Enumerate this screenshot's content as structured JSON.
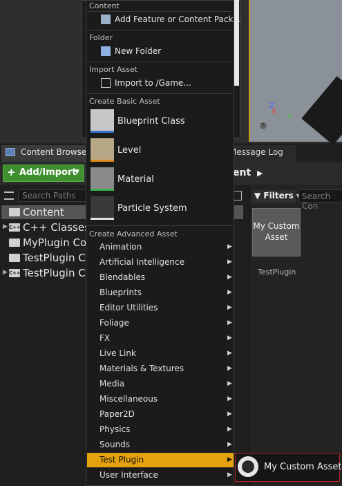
{
  "tabs": {
    "content_browser": "Content Browser",
    "message_log": "Message Log"
  },
  "toolbar": {
    "add_import": "Add/Import",
    "breadcrumb": "ent"
  },
  "left_panel": {
    "search_placeholder": "Search Paths",
    "tree": [
      {
        "label": "Content",
        "kind": "folder",
        "selected": true
      },
      {
        "label": "C++ Classes",
        "kind": "cpp-folder",
        "expandable": true
      },
      {
        "label": "MyPlugin Cor",
        "kind": "folder"
      },
      {
        "label": "TestPlugin Co",
        "kind": "folder"
      },
      {
        "label": "TestPlugin C+",
        "kind": "cpp-folder",
        "expandable": true
      }
    ]
  },
  "right_panel": {
    "filters": "Filters",
    "search_placeholder": "Search Con",
    "asset": {
      "name": "My Custom Asset",
      "folder": "TestPlugin"
    }
  },
  "viewport": {
    "axis_z": "Z",
    "axis_x": "X",
    "axis_y": "Y"
  },
  "menu": {
    "sections": {
      "content": "Content",
      "folder": "Folder",
      "import": "Import Asset",
      "basic": "Create Basic Asset",
      "advanced": "Create Advanced Asset"
    },
    "add_feature": "Add Feature or Content Pack...",
    "new_folder": "New Folder",
    "import_to": "Import to /Game...",
    "basic_items": [
      {
        "label": "Blueprint Class",
        "accent": "#3a78d4"
      },
      {
        "label": "Level",
        "accent": "#e08a1a"
      },
      {
        "label": "Material",
        "accent": "#3ab04a"
      },
      {
        "label": "Particle System",
        "accent": "#e0e0e0"
      }
    ],
    "advanced_items": [
      "Animation",
      "Artificial Intelligence",
      "Blendables",
      "Blueprints",
      "Editor Utilities",
      "Foliage",
      "FX",
      "Live Link",
      "Materials & Textures",
      "Media",
      "Miscellaneous",
      "Paper2D",
      "Physics",
      "Sounds",
      "Test Plugin",
      "User Interface"
    ],
    "highlighted": "Test Plugin",
    "highlight_color": "#e6a10e"
  },
  "submenu": {
    "item": "My Custom Asset"
  }
}
